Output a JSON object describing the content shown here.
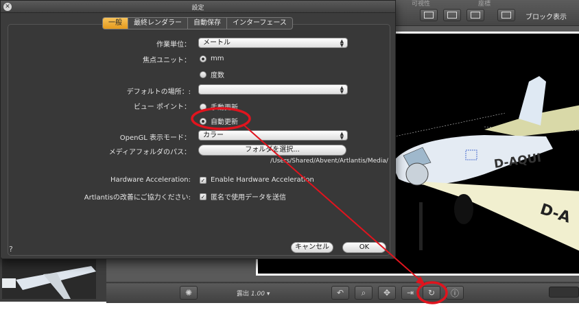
{
  "app": {
    "top_labels": [
      "可視性",
      "座標"
    ],
    "block_display_label": "ブロック表示",
    "exposure_label": "露出",
    "exposure_value": "1.00",
    "exposure_arrow": "▾"
  },
  "dialog": {
    "title": "設定",
    "close_glyph": "✕",
    "tabs": [
      {
        "label": "一般",
        "active": true
      },
      {
        "label": "最終レンダラー",
        "active": false
      },
      {
        "label": "自動保存",
        "active": false
      },
      {
        "label": "インターフェース",
        "active": false
      }
    ],
    "fields": {
      "work_unit_label": "作業単位：",
      "work_unit_value": "メートル",
      "focal_unit_label": "焦点ユニット：",
      "focal_options": [
        {
          "label": "mm",
          "selected": true
        },
        {
          "label": "度数",
          "selected": false
        }
      ],
      "default_location_label": "デフォルトの場所：:",
      "default_location_value": "",
      "viewpoint_label": "ビュー ポイント：",
      "viewpoint_options": [
        {
          "label": "手動更新",
          "selected": false
        },
        {
          "label": "自動更新",
          "selected": true
        }
      ],
      "opengl_label": "OpenGL 表示モード：",
      "opengl_value": "カラー",
      "media_folder_label": "メディアフォルダのパス：",
      "media_folder_button": "フォルダを選択...",
      "media_folder_path": "/Users/Shared/Abvent/Artlantis/Media/",
      "hw_accel_label": "Hardware Acceleration:",
      "hw_accel_checkbox": "Enable Hardware Acceleration",
      "improve_label": "Artlantisの改善にご協力ください:",
      "improve_checkbox": "匿名で使用データを送信"
    },
    "help_glyph": "?",
    "cancel_button": "キャンセル",
    "ok_button": "OK"
  },
  "colors": {
    "accent_tab": "#f0ae3a",
    "annotation_red": "#e0141e",
    "dialog_bg": "#3c3c3c"
  },
  "icons": [
    "close-icon",
    "dropdown-arrows-icon",
    "undo-icon",
    "zoom-icon",
    "pan-icon",
    "refresh-icon",
    "info-icon",
    "gear-icon"
  ]
}
